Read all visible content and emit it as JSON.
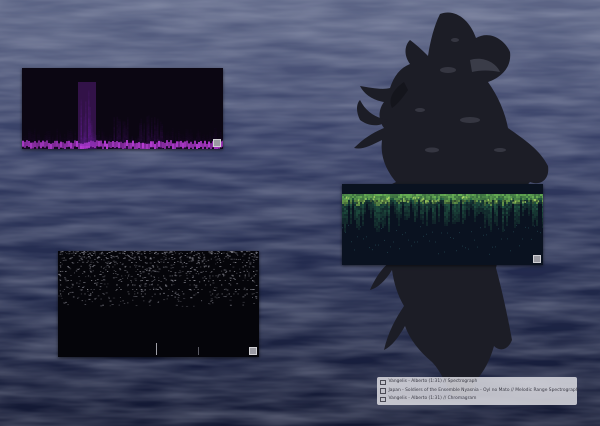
{
  "scene": {
    "ocean_colors": [
      "#6c7598",
      "#3d4670",
      "#242c50",
      "#151a35"
    ],
    "statue_color": "#1c1d26",
    "statue_highlight": "#4a4c58"
  },
  "panels": [
    {
      "name": "spectrograph-panel-1",
      "kind": "magenta-spectrograph",
      "colors": [
        "#0b0612",
        "#5a148c",
        "#b43cd2"
      ]
    },
    {
      "name": "spectrograph-panel-2",
      "kind": "green-spectrograph",
      "colors": [
        "#0a1220",
        "#2f7a55",
        "#8fd35a"
      ]
    },
    {
      "name": "chromagram-panel",
      "kind": "sparse-chromagram",
      "colors": [
        "#05050a",
        "#8a8a95"
      ]
    }
  ],
  "legend": {
    "items": [
      {
        "label": "Vangelis - Alberto (1:31) // Spectrograph"
      },
      {
        "label": "Japan - Soldiers of the Ensemble Nyasnia - Oyl no Mato // Melodic Range Spectrograph"
      },
      {
        "label": "Vangelis - Alberto (1:31) // Chromagram"
      }
    ]
  }
}
